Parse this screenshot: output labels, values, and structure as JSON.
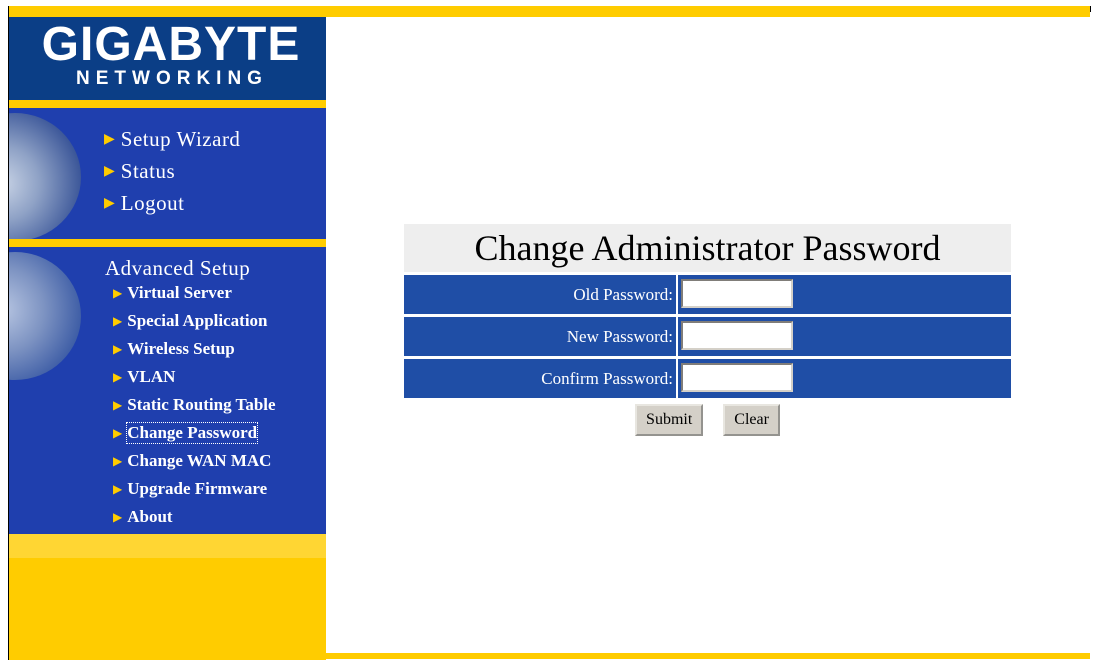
{
  "brand": {
    "main": "GIGABYTE",
    "sub": "NETWORKING"
  },
  "colors": {
    "sidebar_blue": "#1f3fae",
    "logo_blue": "#0b3e86",
    "accent_yellow": "#ffcc00",
    "form_blue": "#1f4ea6"
  },
  "nav": {
    "top_items": [
      {
        "label": "Setup Wizard",
        "icon": "right-triangle-icon"
      },
      {
        "label": "Status",
        "icon": "right-triangle-icon"
      },
      {
        "label": "Logout",
        "icon": "right-triangle-icon"
      }
    ],
    "advanced_title": "Advanced Setup",
    "advanced_items": [
      {
        "label": "Virtual Server",
        "icon": "right-triangle-icon"
      },
      {
        "label": "Special Application",
        "icon": "right-triangle-icon"
      },
      {
        "label": "Wireless Setup",
        "icon": "right-triangle-icon"
      },
      {
        "label": "VLAN",
        "icon": "right-triangle-icon"
      },
      {
        "label": "Static Routing Table",
        "icon": "right-triangle-icon"
      },
      {
        "label": "Change Password",
        "icon": "right-triangle-icon",
        "active": true
      },
      {
        "label": "Change WAN MAC",
        "icon": "right-triangle-icon"
      },
      {
        "label": "Upgrade Firmware",
        "icon": "right-triangle-icon"
      },
      {
        "label": "About",
        "icon": "right-triangle-icon"
      }
    ]
  },
  "form": {
    "title": "Change Administrator Password",
    "fields": [
      {
        "label": "Old Password:",
        "value": ""
      },
      {
        "label": "New Password:",
        "value": ""
      },
      {
        "label": "Confirm Password:",
        "value": ""
      }
    ],
    "submit_label": "Submit",
    "clear_label": "Clear"
  }
}
